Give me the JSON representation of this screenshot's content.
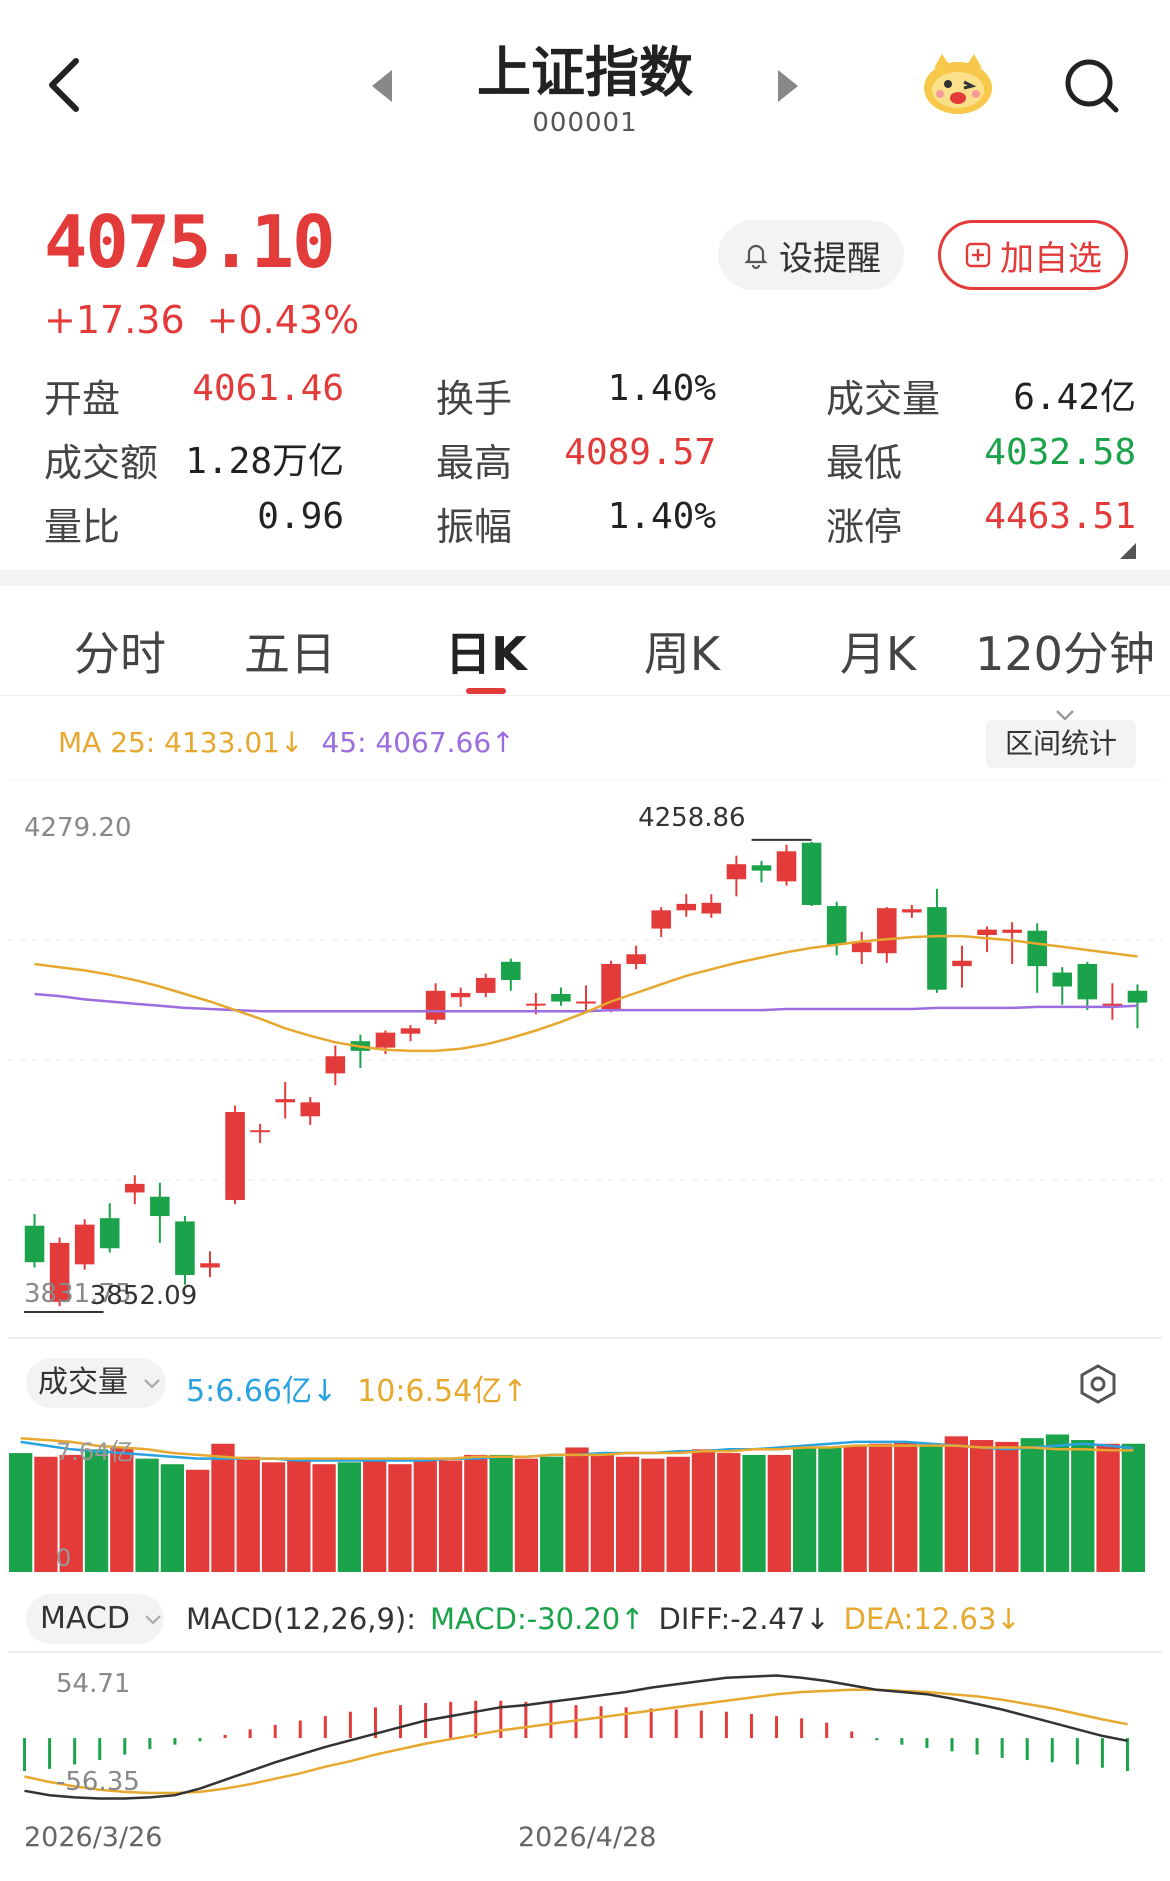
{
  "header": {
    "title": "上证指数",
    "code": "000001"
  },
  "quote": {
    "price": "4075.10",
    "change": "+17.36",
    "change_pct": "+0.43%",
    "alert_label": "设提醒",
    "watch_label": "加自选"
  },
  "stats": [
    [
      {
        "label": "开盘",
        "value": "4061.46",
        "color": "red"
      },
      {
        "label": "换手",
        "value": "1.40%",
        "color": "dark"
      },
      {
        "label": "成交量",
        "value": "6.42亿",
        "color": "dark"
      }
    ],
    [
      {
        "label": "成交额",
        "value": "1.28万亿",
        "color": "dark"
      },
      {
        "label": "最高",
        "value": "4089.57",
        "color": "red"
      },
      {
        "label": "最低",
        "value": "4032.58",
        "color": "green"
      }
    ],
    [
      {
        "label": "量比",
        "value": "0.96",
        "color": "dark"
      },
      {
        "label": "振幅",
        "value": "1.40%",
        "color": "dark"
      },
      {
        "label": "涨停",
        "value": "4463.51",
        "color": "red"
      }
    ]
  ],
  "tabs": [
    "分时",
    "五日",
    "日K",
    "周K",
    "月K",
    "120分钟"
  ],
  "active_tab": "日K",
  "ma": {
    "ma25": "MA 25: 4133.01↓",
    "ma45": "45: 4067.66↑"
  },
  "range_stats_label": "区间统计",
  "volume": {
    "label": "成交量",
    "ma5": "5:6.66亿↓",
    "ma10": "10:6.54亿↑"
  },
  "macd": {
    "label": "MACD",
    "name": "MACD(12,26,9):",
    "macd": "MACD:-30.20↑",
    "diff": "DIFF:-2.47↓",
    "dea": "DEA:12.63↓"
  },
  "chart_data": [
    {
      "type": "candlestick",
      "ylim": [
        3831.75,
        4279.2
      ],
      "y_top_label": "4279.20",
      "annotations": [
        {
          "text": "4258.86",
          "value": 4258.86,
          "index": 31
        },
        {
          "text": "3831.75",
          "value": 3831.75,
          "index": 1
        },
        {
          "text": "3852.09",
          "value": 3852.09,
          "index": 3
        }
      ],
      "candles": [
        {
          "o": 3901,
          "c": 3867,
          "h": 3912,
          "l": 3862
        },
        {
          "o": 3830,
          "c": 3885,
          "h": 3890,
          "l": 3826
        },
        {
          "o": 3865,
          "c": 3902,
          "h": 3907,
          "l": 3860
        },
        {
          "o": 3908,
          "c": 3880,
          "h": 3922,
          "l": 3876
        },
        {
          "o": 3932,
          "c": 3940,
          "h": 3948,
          "l": 3921
        },
        {
          "o": 3928,
          "c": 3910,
          "h": 3941,
          "l": 3885
        },
        {
          "o": 3905,
          "c": 3855,
          "h": 3910,
          "l": 3846
        },
        {
          "o": 3862,
          "c": 3866,
          "h": 3877,
          "l": 3853
        },
        {
          "o": 3925,
          "c": 4007,
          "h": 4013,
          "l": 3921
        },
        {
          "o": 3990,
          "c": 3990,
          "h": 3996,
          "l": 3978
        },
        {
          "o": 4016,
          "c": 4019,
          "h": 4035,
          "l": 4001
        },
        {
          "o": 4003,
          "c": 4016,
          "h": 4021,
          "l": 3995
        },
        {
          "o": 4043,
          "c": 4059,
          "h": 4069,
          "l": 4032
        },
        {
          "o": 4073,
          "c": 4064,
          "h": 4079,
          "l": 4048
        },
        {
          "o": 4067,
          "c": 4081,
          "h": 4083,
          "l": 4061
        },
        {
          "o": 4080,
          "c": 4085,
          "h": 4088,
          "l": 4073
        },
        {
          "o": 4093,
          "c": 4120,
          "h": 4127,
          "l": 4089
        },
        {
          "o": 4114,
          "c": 4118,
          "h": 4123,
          "l": 4105
        },
        {
          "o": 4118,
          "c": 4132,
          "h": 4136,
          "l": 4114
        },
        {
          "o": 4147,
          "c": 4130,
          "h": 4150,
          "l": 4120
        },
        {
          "o": 4108,
          "c": 4108,
          "h": 4118,
          "l": 4098
        },
        {
          "o": 4117,
          "c": 4110,
          "h": 4123,
          "l": 4106
        },
        {
          "o": 4110,
          "c": 4110,
          "h": 4125,
          "l": 4099
        },
        {
          "o": 4103,
          "c": 4145,
          "h": 4148,
          "l": 4100
        },
        {
          "o": 4145,
          "c": 4154,
          "h": 4162,
          "l": 4140
        },
        {
          "o": 4178,
          "c": 4195,
          "h": 4198,
          "l": 4170
        },
        {
          "o": 4195,
          "c": 4201,
          "h": 4210,
          "l": 4189
        },
        {
          "o": 4192,
          "c": 4202,
          "h": 4210,
          "l": 4188
        },
        {
          "o": 4224,
          "c": 4238,
          "h": 4246,
          "l": 4208
        },
        {
          "o": 4237,
          "c": 4232,
          "h": 4241,
          "l": 4221
        },
        {
          "o": 4222,
          "c": 4250,
          "h": 4256,
          "l": 4218
        },
        {
          "o": 4258,
          "c": 4200,
          "h": 4258.86,
          "l": 4199
        },
        {
          "o": 4199,
          "c": 4163,
          "h": 4203,
          "l": 4153
        },
        {
          "o": 4156,
          "c": 4165,
          "h": 4175,
          "l": 4145
        },
        {
          "o": 4155,
          "c": 4197,
          "h": 4198,
          "l": 4146
        },
        {
          "o": 4193,
          "c": 4196,
          "h": 4200,
          "l": 4188
        },
        {
          "o": 4198,
          "c": 4121,
          "h": 4215,
          "l": 4118
        },
        {
          "o": 4143,
          "c": 4148,
          "h": 4162,
          "l": 4123
        },
        {
          "o": 4172,
          "c": 4177,
          "h": 4180,
          "l": 4156
        },
        {
          "o": 4174,
          "c": 4177,
          "h": 4184,
          "l": 4145
        },
        {
          "o": 4176,
          "c": 4143,
          "h": 4183,
          "l": 4118
        },
        {
          "o": 4137,
          "c": 4124,
          "h": 4142,
          "l": 4107
        },
        {
          "o": 4145,
          "c": 4112,
          "h": 4147,
          "l": 4102
        },
        {
          "o": 4108,
          "c": 4108,
          "h": 4127,
          "l": 4093
        },
        {
          "o": 4120,
          "c": 4109,
          "h": 4126,
          "l": 4085
        }
      ],
      "ma25": [
        4145,
        4142,
        4139,
        4135,
        4130,
        4124,
        4117,
        4110,
        4102,
        4094,
        4085,
        4078,
        4072,
        4068,
        4065,
        4064,
        4064,
        4066,
        4070,
        4076,
        4083,
        4091,
        4100,
        4110,
        4118,
        4126,
        4134,
        4140,
        4146,
        4151,
        4156,
        4160,
        4163,
        4166,
        4168,
        4170,
        4171,
        4171,
        4169,
        4167,
        4164,
        4161,
        4158,
        4155,
        4152
      ],
      "ma45": [
        4117,
        4115,
        4112,
        4110,
        4108,
        4106,
        4104,
        4103,
        4102,
        4101,
        4101,
        4101,
        4101,
        4101,
        4101,
        4101,
        4101,
        4101,
        4101,
        4101,
        4101,
        4101,
        4101,
        4102,
        4102,
        4102,
        4102,
        4102,
        4102,
        4102,
        4103,
        4103,
        4103,
        4103,
        4103,
        4103,
        4104,
        4104,
        4104,
        4104,
        4105,
        4105,
        4105,
        4105,
        4106
      ]
    },
    {
      "type": "bar",
      "title": "成交量",
      "y_top_label": "7.64亿",
      "y_bottom_label": "0",
      "ylim": [
        0,
        7.64
      ],
      "values": [
        6.4,
        6.2,
        6.3,
        6.6,
        6.7,
        6.1,
        5.8,
        5.5,
        6.9,
        6.2,
        5.9,
        6.0,
        5.8,
        5.9,
        6.0,
        5.8,
        6.0,
        6.0,
        6.3,
        6.3,
        6.1,
        6.2,
        6.7,
        6.4,
        6.2,
        6.1,
        6.2,
        6.6,
        6.4,
        6.3,
        6.3,
        6.7,
        6.7,
        6.8,
        6.9,
        7.0,
        6.9,
        7.3,
        7.1,
        7.0,
        7.2,
        7.4,
        7.1,
        6.9,
        6.9
      ],
      "ma5": [
        7.0,
        6.8,
        6.6,
        6.5,
        6.4,
        6.3,
        6.2,
        6.1,
        6.1,
        6.1,
        6.1,
        6.0,
        6.0,
        6.0,
        6.0,
        6.0,
        6.0,
        6.1,
        6.1,
        6.2,
        6.2,
        6.3,
        6.3,
        6.4,
        6.4,
        6.4,
        6.5,
        6.5,
        6.6,
        6.6,
        6.7,
        6.8,
        6.9,
        7.0,
        7.0,
        7.0,
        6.9,
        6.8,
        6.7,
        6.6,
        6.7,
        6.8,
        6.9,
        6.8,
        6.66
      ],
      "ma10": [
        7.2,
        7.1,
        7.0,
        6.8,
        6.7,
        6.6,
        6.4,
        6.3,
        6.2,
        6.1,
        6.1,
        6.1,
        6.1,
        6.1,
        6.1,
        6.1,
        6.1,
        6.1,
        6.2,
        6.2,
        6.2,
        6.3,
        6.3,
        6.3,
        6.4,
        6.4,
        6.4,
        6.5,
        6.5,
        6.6,
        6.6,
        6.7,
        6.7,
        6.8,
        6.8,
        6.8,
        6.8,
        6.8,
        6.7,
        6.7,
        6.7,
        6.6,
        6.6,
        6.55,
        6.54
      ]
    },
    {
      "type": "macd",
      "y_top_label": "54.71",
      "y_bottom_label": "-56.35",
      "ylim": [
        -56.35,
        54.71
      ],
      "hist": [
        -30,
        -28,
        -24,
        -20,
        -15,
        -10,
        -6,
        -3,
        3,
        8,
        12,
        16,
        20,
        24,
        28,
        30,
        32,
        33,
        34,
        34,
        33,
        32,
        30,
        29,
        28,
        27,
        26,
        25,
        24,
        22,
        20,
        18,
        14,
        6,
        -2,
        -6,
        -9,
        -12,
        -15,
        -18,
        -20,
        -22,
        -24,
        -27,
        -30
      ],
      "diff": [
        -48,
        -52,
        -54,
        -55,
        -55,
        -54,
        -52,
        -46,
        -38,
        -30,
        -22,
        -15,
        -8,
        -2,
        4,
        10,
        16,
        20,
        24,
        28,
        30,
        33,
        36,
        39,
        42,
        46,
        49,
        52,
        55,
        56,
        57,
        55,
        52,
        48,
        44,
        42,
        40,
        36,
        31,
        26,
        20,
        14,
        8,
        2,
        -2.47
      ],
      "dea": [
        -35,
        -40,
        -44,
        -47,
        -49,
        -50,
        -50,
        -49,
        -46,
        -42,
        -37,
        -32,
        -26,
        -21,
        -15,
        -10,
        -5,
        -1,
        3,
        7,
        10,
        13,
        16,
        19,
        22,
        25,
        28,
        31,
        34,
        37,
        40,
        42,
        43,
        44,
        44,
        43,
        42,
        40,
        38,
        35,
        31,
        27,
        22,
        17,
        12.63
      ]
    }
  ],
  "dates": [
    "2026/3/26",
    "2026/4/28"
  ]
}
